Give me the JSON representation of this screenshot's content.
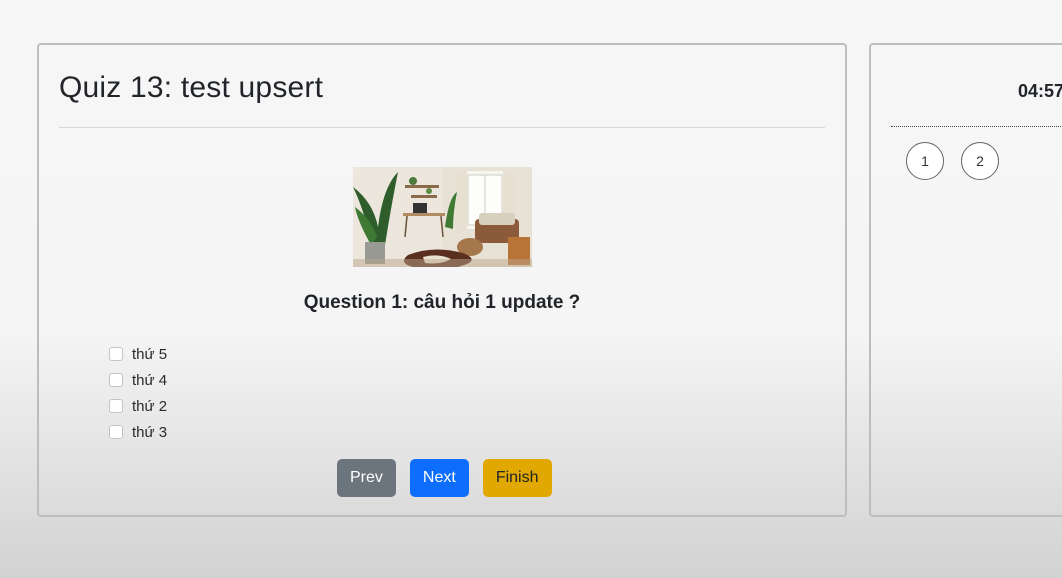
{
  "quiz": {
    "title": "Quiz 13: test upsert",
    "question": "Question 1: câu hỏi 1 update ?",
    "image_icon": "living-room-photo",
    "answers": [
      {
        "label": "thứ 5",
        "checked": false
      },
      {
        "label": "thứ 4",
        "checked": false
      },
      {
        "label": "thứ 2",
        "checked": false
      },
      {
        "label": "thứ 3",
        "checked": false
      }
    ],
    "buttons": {
      "prev": "Prev",
      "next": "Next",
      "finish": "Finish"
    }
  },
  "sidebar": {
    "timer": "04:57",
    "questions": [
      "1",
      "2"
    ]
  },
  "colors": {
    "prev": "#6c757d",
    "next": "#0d6efd",
    "finish": "#e0a800"
  }
}
